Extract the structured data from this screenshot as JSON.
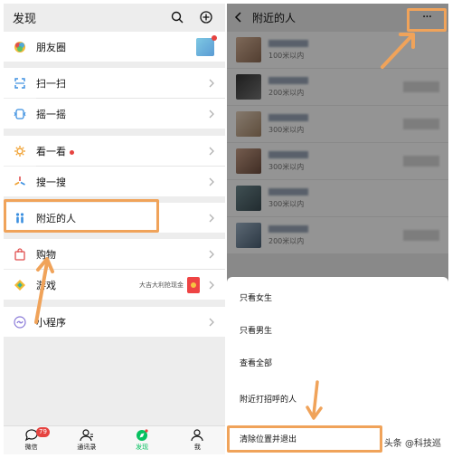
{
  "left": {
    "header": {
      "title": "发现",
      "search_icon": "search-icon",
      "add_icon": "add-circle-icon"
    },
    "rows": {
      "moments": "朋友圈",
      "scan": "扫一扫",
      "shake": "摇一摇",
      "top_stories": "看一看",
      "search": "搜一搜",
      "nearby": "附近的人",
      "shopping": "购物",
      "games": "游戏",
      "games_promo": "大吉大利抢现金",
      "mini_programs": "小程序"
    },
    "tabbar": {
      "chats": "微信",
      "chats_badge": "79",
      "contacts": "通讯录",
      "discover": "发现",
      "me": "我"
    }
  },
  "right": {
    "header": {
      "title": "附近的人",
      "more": "···"
    },
    "people": [
      {
        "distance": "100米以内"
      },
      {
        "distance": "200米以内"
      },
      {
        "distance": "300米以内"
      },
      {
        "distance": "300米以内"
      },
      {
        "distance": "300米以内"
      },
      {
        "distance": "200米以内"
      }
    ],
    "sheet": {
      "female_only": "只看女生",
      "male_only": "只看男生",
      "view_all": "查看全部",
      "greeted": "附近打招呼的人",
      "clear_exit": "清除位置并退出"
    },
    "watermark": "头条 @科技巡"
  },
  "colors": {
    "accent": "#07c160",
    "badge": "#e64340",
    "highlight": "#f0a35a"
  }
}
